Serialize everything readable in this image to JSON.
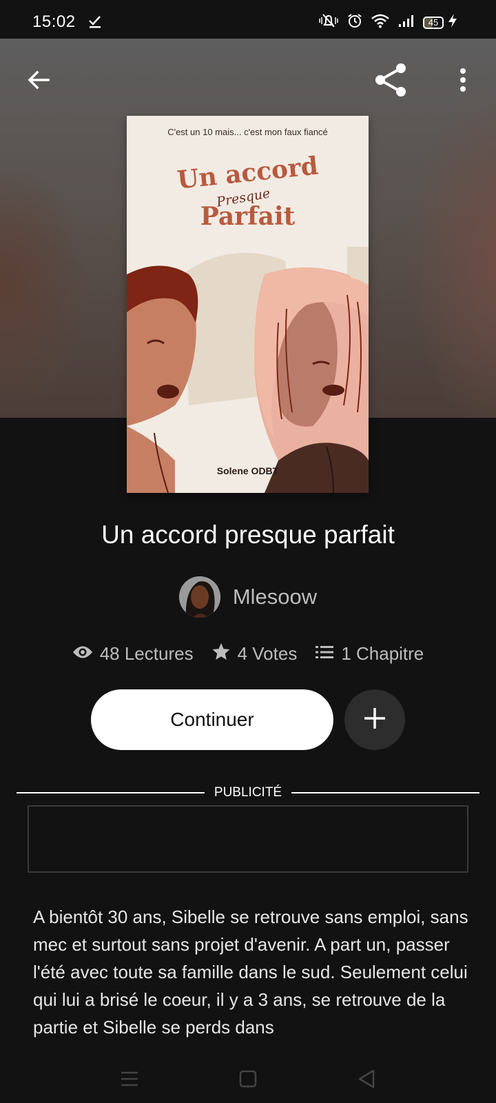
{
  "status_bar": {
    "time": "15:02",
    "battery": "45",
    "battery_level_percent": 45,
    "icons": [
      "download-done-icon",
      "mute-icon",
      "alarm-icon",
      "wifi-icon",
      "signal-icon",
      "battery-icon",
      "charging-icon"
    ]
  },
  "top_bar": {
    "back_icon": "arrow-left-icon",
    "share_icon": "share-icon",
    "more_icon": "more-vertical-icon"
  },
  "cover": {
    "tagline": "C'est un 10 mais... c'est mon faux fiancé",
    "title_line1": "Un accord",
    "title_script": "Presque",
    "title_line2": "Parfait",
    "author": "Solene ODBT"
  },
  "book": {
    "title": "Un accord presque parfait",
    "author_name": "Mlesoow"
  },
  "stats": {
    "reads": "48 Lectures",
    "votes": "4 Votes",
    "chapters": "1 Chapitre"
  },
  "actions": {
    "continue_label": "Continuer",
    "add_icon": "plus-icon"
  },
  "ad": {
    "label": "PUBLICITÉ"
  },
  "synopsis": "A bientôt 30 ans, Sibelle se retrouve sans emploi, sans mec et surtout sans projet d'avenir. A part un, passer l'été avec toute sa famille dans le sud. Seulement celui qui lui a brisé le coeur, il y a 3 ans, se retrouve de la partie et Sibelle se perds dans",
  "nav_bar": {
    "icons": [
      "menu-icon",
      "home-square-icon",
      "back-triangle-icon"
    ]
  },
  "colors": {
    "background": "#121212",
    "cover_title": "#b85a3f",
    "button_bg": "#ffffff",
    "add_button_bg": "#2d2d2d"
  }
}
